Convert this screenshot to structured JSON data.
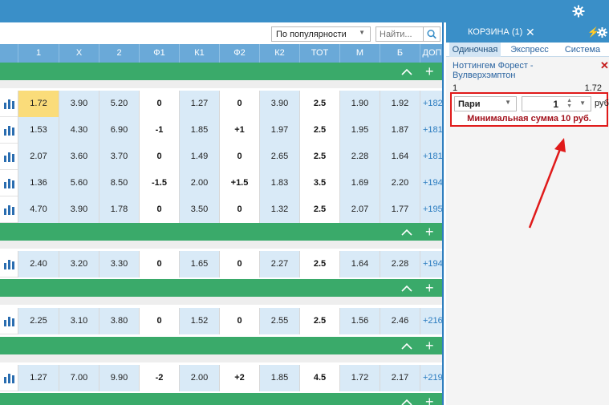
{
  "top": {
    "icon": "gear-icon"
  },
  "toolbar": {
    "sort_value": "По популярности",
    "search_placeholder": "Найти..."
  },
  "columns": [
    "1",
    "X",
    "2",
    "Ф1",
    "К1",
    "Ф2",
    "К2",
    "ТОТ",
    "М",
    "Б",
    "ДОП"
  ],
  "rows": [
    [
      "1.72",
      "3.90",
      "5.20",
      "0",
      "1.27",
      "0",
      "3.90",
      "2.5",
      "1.90",
      "1.92",
      "+182"
    ],
    [
      "1.53",
      "4.30",
      "6.90",
      "-1",
      "1.85",
      "+1",
      "1.97",
      "2.5",
      "1.95",
      "1.87",
      "+181"
    ],
    [
      "2.07",
      "3.60",
      "3.70",
      "0",
      "1.49",
      "0",
      "2.65",
      "2.5",
      "2.28",
      "1.64",
      "+181"
    ],
    [
      "1.36",
      "5.60",
      "8.50",
      "-1.5",
      "2.00",
      "+1.5",
      "1.83",
      "3.5",
      "1.69",
      "2.20",
      "+194"
    ],
    [
      "4.70",
      "3.90",
      "1.78",
      "0",
      "3.50",
      "0",
      "1.32",
      "2.5",
      "2.07",
      "1.77",
      "+195"
    ],
    [
      "2.40",
      "3.20",
      "3.30",
      "0",
      "1.65",
      "0",
      "2.27",
      "2.5",
      "1.64",
      "2.28",
      "+194"
    ],
    [
      "2.25",
      "3.10",
      "3.80",
      "0",
      "1.52",
      "0",
      "2.55",
      "2.5",
      "1.56",
      "2.46",
      "+216"
    ],
    [
      "1.27",
      "7.00",
      "9.90",
      "-2",
      "2.00",
      "+2",
      "1.85",
      "4.5",
      "1.72",
      "2.17",
      "+219"
    ]
  ],
  "highlighted_cell": {
    "row": 0,
    "col": 0
  },
  "cart": {
    "title": "КОРЗИНА (1)",
    "tabs": [
      "Одиночная",
      "Экспресс",
      "Система"
    ],
    "active_tab": 0,
    "event": "Ноттингем Форест - Вулверхэмптон",
    "outcome": "1",
    "odds": "1.72",
    "bet_type": "Пари",
    "amount": "1",
    "currency": "руб",
    "min_message": "Минимальная сумма 10 руб."
  },
  "colors": {
    "accent": "#3a8fc8",
    "green": "#3aaa6a",
    "highlight": "#fadc7a",
    "alert": "#e01a1a"
  }
}
